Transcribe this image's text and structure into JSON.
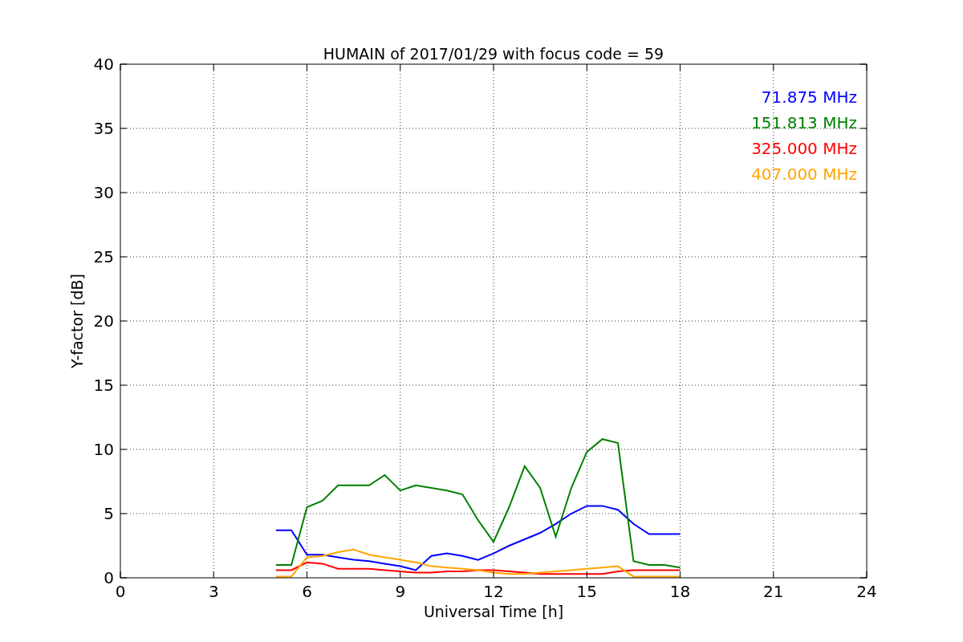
{
  "chart_data": {
    "type": "line",
    "title": "HUMAIN of 2017/01/29 with focus code = 59",
    "xlabel": "Universal Time [h]",
    "ylabel": "Y-factor [dB]",
    "x": [
      5,
      5.5,
      6,
      6.5,
      7,
      7.5,
      8,
      8.5,
      9,
      9.5,
      10,
      10.5,
      11,
      11.5,
      12,
      12.5,
      13,
      13.5,
      14,
      14.5,
      15,
      15.5,
      16,
      16.5,
      17,
      17.5,
      18
    ],
    "series": [
      {
        "name": "71.875 MHz",
        "color": "#0000ff",
        "values": [
          3.7,
          3.7,
          1.8,
          1.8,
          1.6,
          1.4,
          1.3,
          1.1,
          0.9,
          0.6,
          1.7,
          1.9,
          1.7,
          1.4,
          1.9,
          2.5,
          3.0,
          3.5,
          4.2,
          5.0,
          5.6,
          5.6,
          5.3,
          4.2,
          3.4,
          3.4,
          3.4
        ]
      },
      {
        "name": "151.813 MHz",
        "color": "#008000",
        "values": [
          1.0,
          1.0,
          5.5,
          6.0,
          7.2,
          7.2,
          7.2,
          8.0,
          6.8,
          7.2,
          7.0,
          6.8,
          6.5,
          4.5,
          2.8,
          5.5,
          8.7,
          7.0,
          3.2,
          7.0,
          9.8,
          10.8,
          10.5,
          1.3,
          1.0,
          1.0,
          0.8
        ]
      },
      {
        "name": "325.000 MHz",
        "color": "#ff0000",
        "values": [
          0.6,
          0.6,
          1.2,
          1.1,
          0.7,
          0.7,
          0.7,
          0.6,
          0.5,
          0.4,
          0.4,
          0.5,
          0.5,
          0.6,
          0.6,
          0.5,
          0.4,
          0.3,
          0.3,
          0.3,
          0.3,
          0.3,
          0.5,
          0.6,
          0.6,
          0.6,
          0.6
        ]
      },
      {
        "name": "407.000 MHz",
        "color": "#ffa500",
        "values": [
          0.1,
          0.1,
          1.6,
          1.7,
          2.0,
          2.2,
          1.8,
          1.6,
          1.4,
          1.2,
          0.9,
          0.8,
          0.7,
          0.6,
          0.4,
          0.3,
          0.3,
          0.4,
          0.5,
          0.6,
          0.7,
          0.8,
          0.9,
          0.1,
          0.1,
          0.1,
          0.1
        ]
      }
    ],
    "xlim": [
      0,
      24
    ],
    "ylim": [
      0,
      40
    ],
    "xticks": [
      0,
      3,
      6,
      9,
      12,
      15,
      18,
      21,
      24
    ],
    "yticks": [
      0,
      5,
      10,
      15,
      20,
      25,
      30,
      35,
      40
    ],
    "grid": true
  }
}
